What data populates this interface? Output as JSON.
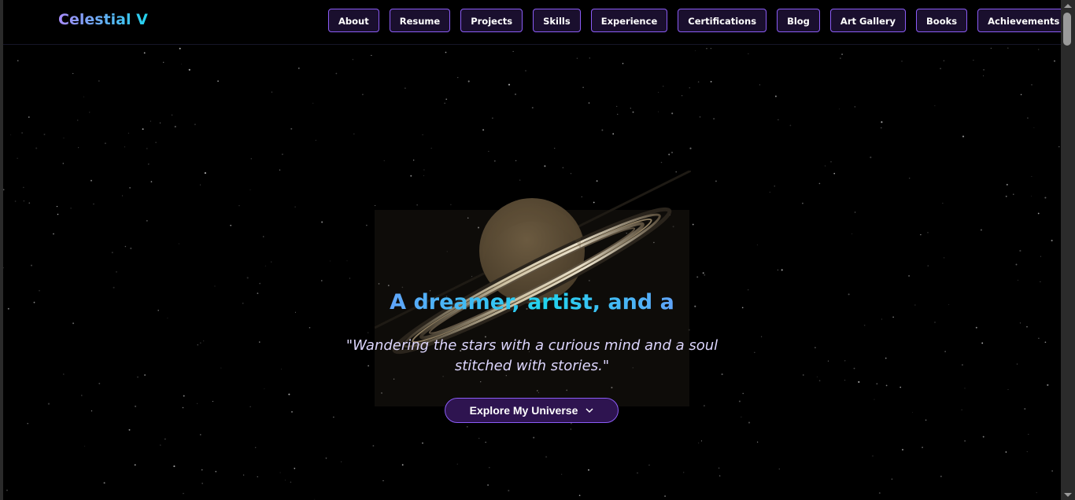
{
  "site": {
    "brand": "Celestial V"
  },
  "nav": {
    "items": [
      {
        "label": "About"
      },
      {
        "label": "Resume"
      },
      {
        "label": "Projects"
      },
      {
        "label": "Skills"
      },
      {
        "label": "Experience"
      },
      {
        "label": "Certifications"
      },
      {
        "label": "Blog"
      },
      {
        "label": "Art Gallery"
      },
      {
        "label": "Books"
      },
      {
        "label": "Achievements"
      }
    ]
  },
  "hero": {
    "headline": "A dreamer, artist, and a",
    "tagline": "\"Wandering the stars with a curious mind and a soul stitched with stories.\"",
    "cta_label": "Explore My Universe",
    "cta_icon": "chevron-down-icon"
  },
  "colors": {
    "background": "#000000",
    "accent": "#8b5cf6",
    "button_fill": "#2e1450",
    "headline": "#60a5fa",
    "tagline": "#ddd6fe"
  }
}
